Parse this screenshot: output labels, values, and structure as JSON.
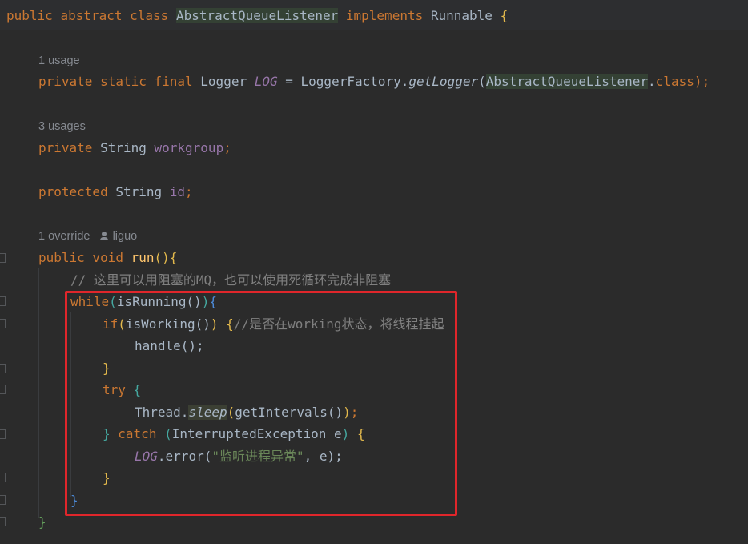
{
  "header_line": {
    "kw_public": "public",
    "kw_abstract": "abstract",
    "kw_class": "class",
    "class_name": "AbstractQueueListener",
    "kw_implements": "implements",
    "interface": "Runnable",
    "brace": "{"
  },
  "hints": {
    "log_usage": "1 usage",
    "workgroup_usage": "3 usages",
    "run_override": "1 override",
    "run_author": "liguo"
  },
  "log_line": {
    "modifiers": "private static final",
    "type": " Logger ",
    "name": "LOG",
    "assign": " = LoggerFactory.",
    "method": "getLogger",
    "paren_open": "(",
    "arg": "AbstractQueueListener",
    "dot": ".",
    "kw_class": "class",
    "tail": ");"
  },
  "workgroup_line": {
    "modifier": "private",
    "type": " String ",
    "name": "workgroup",
    "semi": ";"
  },
  "id_line": {
    "modifier": "protected",
    "type": " String ",
    "name": "id",
    "semi": ";"
  },
  "run_line": {
    "modifiers": "public void",
    "name": "run",
    "parens": "()",
    "brace": "{"
  },
  "comment_line": "// 这里可以用阻塞的MQ，也可以使用死循环完成非阻塞",
  "while_line": {
    "kw": "while",
    "paren_open": "(",
    "call": "isRunning()",
    "paren_close": ")",
    "brace": "{"
  },
  "if_line": {
    "kw": "if",
    "paren_open": "(",
    "call": "isWorking()",
    "paren_close": ")",
    "brace": "{",
    "comment": "//是否在working状态，将线程挂起"
  },
  "handle_line": "handle();",
  "if_close": "}",
  "try_line": {
    "kw": "try",
    "brace": "{"
  },
  "sleep_line": {
    "prefix": "Thread.",
    "method": "sleep",
    "paren_open": "(",
    "arg": "getIntervals()",
    "paren_close": ")",
    "tail": ";"
  },
  "catch_line": {
    "close_brace": "}",
    "kw": "catch",
    "paren_open": "(",
    "param": "InterruptedException e",
    "paren_close": ")",
    "brace": "{"
  },
  "error_line": {
    "field": "LOG",
    "call": ".error(",
    "str": "\"监听进程异常\"",
    "tail": ", e);"
  },
  "catch_close": "}",
  "while_close": "}",
  "run_close": "}",
  "colors": {
    "background": "#2b2b2b",
    "keyword": "#cc7832",
    "field": "#9876aa",
    "string": "#6a8759",
    "comment": "#808080",
    "method_declaration": "#ffc66d",
    "highlight_box": "#e0262b"
  }
}
